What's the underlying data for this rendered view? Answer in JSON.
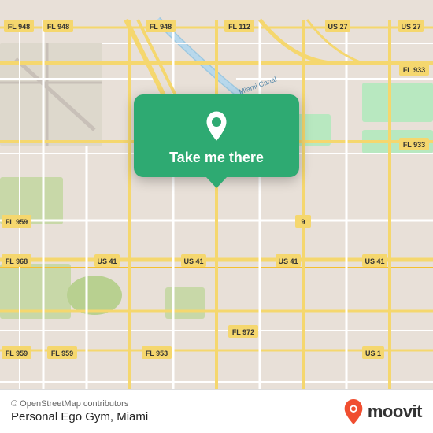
{
  "map": {
    "bg_color": "#e8e0d8",
    "road_color_main": "#f5d76e",
    "road_color_secondary": "#ffffff",
    "road_color_highway": "#f5c842",
    "water_color": "#a8cce0"
  },
  "popup": {
    "bg_color": "#2eaa72",
    "button_label": "Take me there",
    "pin_color": "#ffffff"
  },
  "bottom_bar": {
    "attribution": "© OpenStreetMap contributors",
    "place_name": "Personal Ego Gym, Miami",
    "moovit_label": "moovit"
  }
}
